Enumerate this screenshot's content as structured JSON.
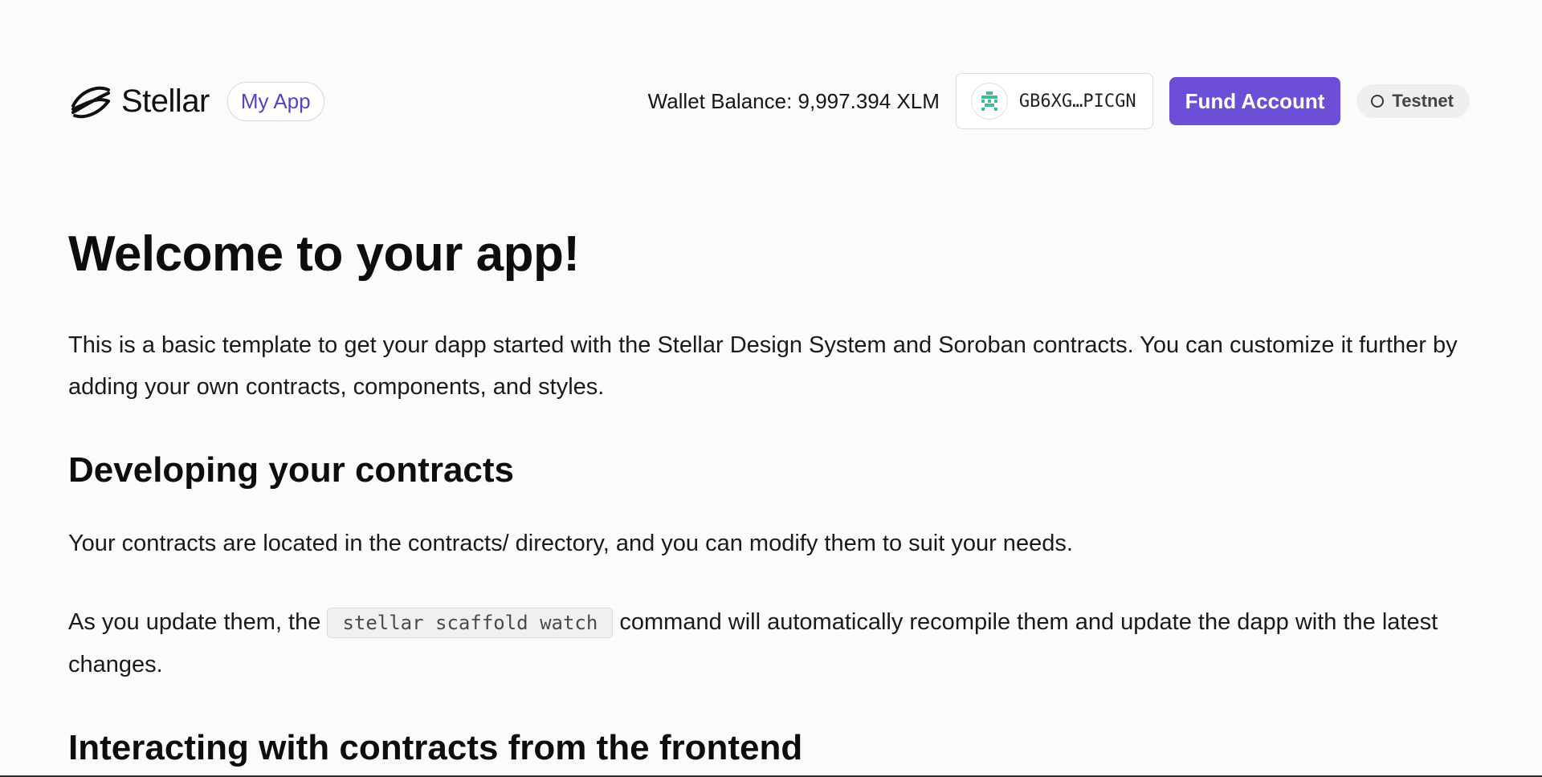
{
  "header": {
    "logo_text": "Stellar",
    "app_name": "My App",
    "wallet_balance": "Wallet Balance: 9,997.394 XLM",
    "address": "GB6XG…PICGN",
    "fund_button": "Fund Account",
    "network": "Testnet"
  },
  "main": {
    "title": "Welcome to your app!",
    "intro": "This is a basic template to get your dapp started with the Stellar Design System and Soroban contracts. You can customize it further by adding your own contracts, components, and styles.",
    "section1": {
      "heading": "Developing your contracts",
      "para1": "Your contracts are located in the contracts/ directory, and you can modify them to suit your needs.",
      "para2_before": "As you update them, the ",
      "code": "stellar scaffold watch",
      "para2_after": " command will automatically recompile them and update the dapp with the latest changes."
    },
    "section2": {
      "heading": "Interacting with contracts from the frontend"
    }
  },
  "colors": {
    "accent": "#6c4fd6",
    "app_pill_text": "#5b3fc4",
    "background": "#fbfbfb"
  }
}
